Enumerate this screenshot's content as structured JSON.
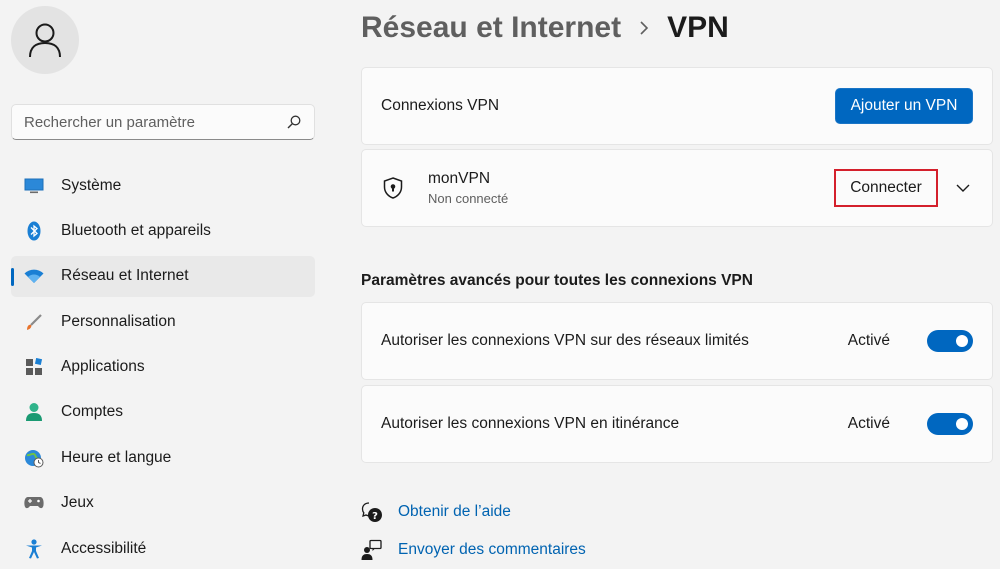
{
  "sidebar": {
    "search_placeholder": "Rechercher un paramètre",
    "items": [
      {
        "label": "Système",
        "icon": "monitor-icon"
      },
      {
        "label": "Bluetooth et appareils",
        "icon": "bluetooth-icon"
      },
      {
        "label": "Réseau et Internet",
        "icon": "wifi-icon",
        "selected": true
      },
      {
        "label": "Personnalisation",
        "icon": "brush-icon"
      },
      {
        "label": "Applications",
        "icon": "apps-icon"
      },
      {
        "label": "Comptes",
        "icon": "person-icon"
      },
      {
        "label": "Heure et langue",
        "icon": "globe-clock-icon"
      },
      {
        "label": "Jeux",
        "icon": "gamepad-icon"
      },
      {
        "label": "Accessibilité",
        "icon": "accessibility-icon"
      }
    ]
  },
  "breadcrumb": {
    "parent": "Réseau et Internet",
    "current": "VPN"
  },
  "vpn_connections": {
    "label": "Connexions VPN",
    "add_button": "Ajouter un VPN"
  },
  "vpn_item": {
    "name": "monVPN",
    "status": "Non connecté",
    "connect_button": "Connecter"
  },
  "advanced": {
    "title": "Paramètres avancés pour toutes les connexions VPN",
    "settings": [
      {
        "label": "Autoriser les connexions VPN sur des réseaux limités",
        "state": "Activé",
        "on": true
      },
      {
        "label": "Autoriser les connexions VPN en itinérance",
        "state": "Activé",
        "on": true
      }
    ]
  },
  "links": {
    "help": "Obtenir de l’aide",
    "feedback": "Envoyer des commentaires"
  },
  "colors": {
    "accent": "#0067c0",
    "highlight_border": "#d4202c"
  }
}
